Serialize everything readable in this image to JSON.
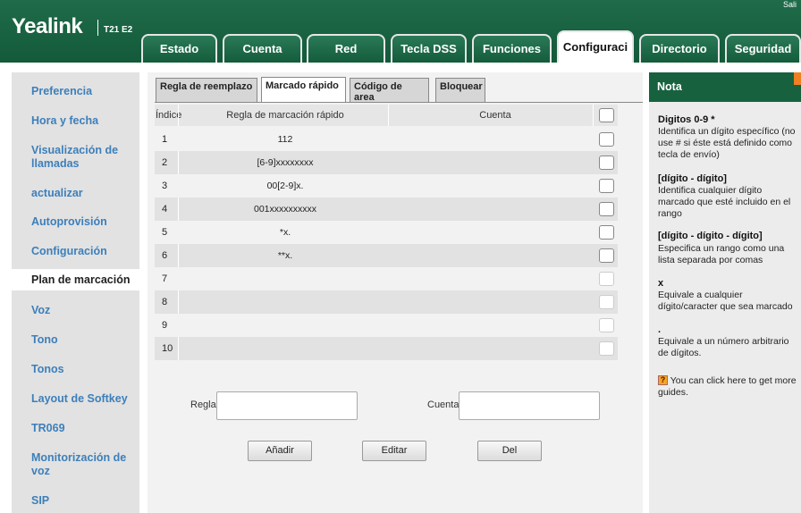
{
  "header": {
    "logo": "Yealink",
    "model": "T21 E2",
    "logout": "Sali",
    "tabs": [
      "Estado",
      "Cuenta",
      "Red",
      "Tecla DSS",
      "Funciones",
      "Configuraci",
      "Directorio",
      "Seguridad"
    ],
    "active_tab": "Configuraci"
  },
  "sidebar": {
    "items": [
      "Preferencia",
      "Hora y fecha",
      "Visualización de llamadas",
      "actualizar",
      "Autoprovisión",
      "Configuración",
      "Plan de marcación",
      "Voz",
      "Tono",
      "Tonos",
      "Layout de Softkey",
      "TR069",
      "Monitorización de voz",
      "SIP"
    ],
    "active": "Plan de marcación"
  },
  "subtabs": [
    "Regla de reemplazo",
    "Marcado rápido",
    "Código de area",
    "Bloquear"
  ],
  "active_subtab": "Marcado rápido",
  "table": {
    "headers": [
      "Índice",
      "Regla de marcación rápido",
      "Cuenta"
    ],
    "rows": [
      {
        "index": "1",
        "rule": "112",
        "account": ""
      },
      {
        "index": "2",
        "rule": "[6-9]xxxxxxxx",
        "account": ""
      },
      {
        "index": "3",
        "rule": "00[2-9]x.",
        "account": ""
      },
      {
        "index": "4",
        "rule": "001xxxxxxxxxx",
        "account": ""
      },
      {
        "index": "5",
        "rule": "*x.",
        "account": ""
      },
      {
        "index": "6",
        "rule": "**x.",
        "account": ""
      },
      {
        "index": "7",
        "rule": "",
        "account": ""
      },
      {
        "index": "8",
        "rule": "",
        "account": ""
      },
      {
        "index": "9",
        "rule": "",
        "account": ""
      },
      {
        "index": "10",
        "rule": "",
        "account": ""
      }
    ]
  },
  "form": {
    "rule_label": "Regla",
    "rule_value": "",
    "account_label": "Cuenta",
    "account_value": "",
    "add_button": "Añadir",
    "edit_button": "Editar",
    "delete_button": "Del"
  },
  "note": {
    "title": "Nota",
    "entries": [
      {
        "title": "Digitos 0-9 *",
        "text": "Identifica un dígito específico (no use # si éste está definido como tecla de envío)"
      },
      {
        "title": "[dígito - dígito]",
        "text": "Identifica cualquier dígito marcado que esté incluido en el rango"
      },
      {
        "title": "[dígito - dígito - dígito]",
        "text": "Especifica un rango como una lista separada por comas"
      },
      {
        "title": "x",
        "text": "Equivale a cualquier dígito/caracter que sea marcado"
      },
      {
        "title": ".",
        "text": "Equivale a un número arbitrario de dígitos."
      }
    ],
    "guide_text": "You can click here to get more guides."
  },
  "colors": {
    "header_green": "#1f6b4a",
    "note_header": "#17613f",
    "link_blue": "#3d7fba",
    "accent_orange": "#f08020"
  }
}
